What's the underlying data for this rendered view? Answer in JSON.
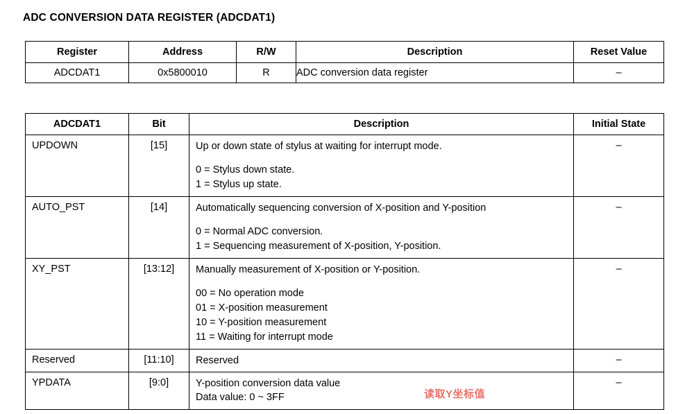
{
  "page": {
    "title": "ADC CONVERSION DATA REGISTER (ADCDAT1)",
    "annotation_color": "#e8736a"
  },
  "register_summary": {
    "headers": {
      "register": "Register",
      "address": "Address",
      "rw": "R/W",
      "description": "Description",
      "reset_value": "Reset Value"
    },
    "row": {
      "register": "ADCDAT1",
      "address": "0x5800010",
      "rw": "R",
      "description": "ADC conversion data register",
      "reset_value": "–"
    }
  },
  "bitfields": {
    "headers": {
      "name": "ADCDAT1",
      "bit": "Bit",
      "description": "Description",
      "initial_state": "Initial State"
    },
    "rows": [
      {
        "name": "UPDOWN",
        "bit": "[15]",
        "desc_head": "Up or down state of stylus at waiting for interrupt mode.",
        "options": [
          "0 = Stylus down state.",
          "1 = Stylus up state."
        ],
        "initial_state": "–"
      },
      {
        "name": "AUTO_PST",
        "bit": "[14]",
        "desc_head": "Automatically sequencing conversion of X-position and Y-position",
        "options": [
          "0 = Normal ADC conversion.",
          "1 = Sequencing measurement of X-position, Y-position."
        ],
        "initial_state": "–"
      },
      {
        "name": "XY_PST",
        "bit": "[13:12]",
        "desc_head": "Manually measurement of X-position or Y-position.",
        "options": [
          "00 = No operation mode",
          "01 = X-position measurement",
          "10 = Y-position measurement",
          "11 = Waiting for interrupt mode"
        ],
        "initial_state": "–"
      },
      {
        "name": "Reserved",
        "bit": "[11:10]",
        "desc_head": "Reserved",
        "options": [],
        "initial_state": "–"
      },
      {
        "name": "YPDATA",
        "bit": "[9:0]",
        "desc_head": "Y-position conversion data value",
        "desc_sub": "Data value:  0 ~ 3FF",
        "annotation": "读取Y坐标值",
        "options": [],
        "initial_state": "–"
      }
    ]
  }
}
